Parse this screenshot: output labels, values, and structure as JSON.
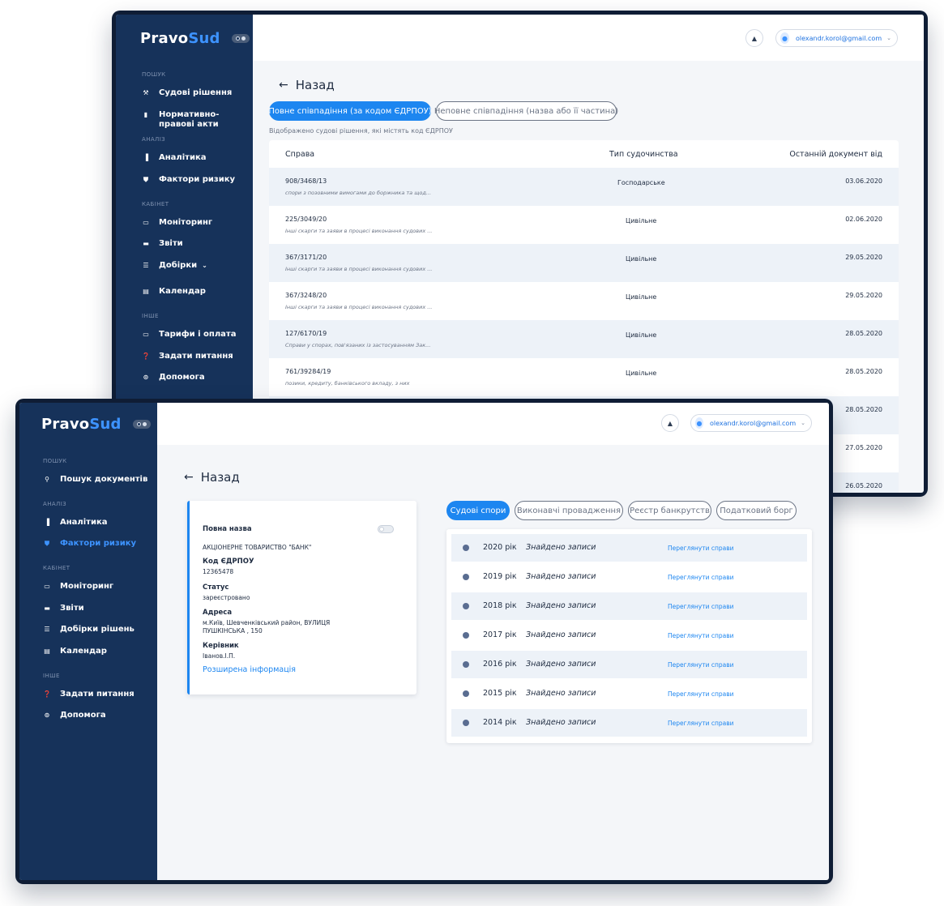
{
  "brand": {
    "name_a": "Pravo",
    "name_b": "Sud"
  },
  "back_label": "Назад",
  "win_back": {
    "sidebar": {
      "sections": [
        {
          "label": "ПОШУК",
          "items": [
            {
              "label": "Судові рішення",
              "icon": "gavel-icon"
            },
            {
              "label": "Нормативно-правові акти",
              "icon": "document-icon"
            }
          ]
        },
        {
          "label": "АНАЛІЗ",
          "items": [
            {
              "label": "Аналітика",
              "icon": "bar-chart-icon"
            },
            {
              "label": "Фактори ризику",
              "icon": "shield-icon"
            }
          ]
        },
        {
          "label": "КАБІНЕТ",
          "items": [
            {
              "label": "Моніторинг",
              "icon": "monitor-icon"
            },
            {
              "label": "Звіти",
              "icon": "folder-icon"
            },
            {
              "label": "Добірки",
              "icon": "list-icon"
            },
            {
              "label": "Календар",
              "icon": "calendar-icon"
            }
          ]
        },
        {
          "label": "ІНШЕ",
          "items": [
            {
              "label": "Тарифи і оплата",
              "icon": "card-icon"
            },
            {
              "label": "Задати питання",
              "icon": "question-icon"
            },
            {
              "label": "Допомога",
              "icon": "help-icon"
            }
          ]
        }
      ]
    },
    "user_email": "olexandr.korol@gmail.com",
    "tabs": [
      "Повне співпадіння (за кодом ЄДРПОУ)",
      "Неповне співпадіння (назва або її частина)"
    ],
    "note": "Відображено судові рішення, які містять код ЄДРПОУ",
    "columns": [
      "Справа",
      "Тип судочинства",
      "Останній документ від"
    ],
    "rows": [
      {
        "case": "908/3468/13",
        "desc": "спори з позовними вимогами до боржника та щод...",
        "type": "Господарське",
        "date": "03.06.2020"
      },
      {
        "case": "225/3049/20",
        "desc": "Інші скарги та заяви в процесі виконання судових ...",
        "type": "Цивільне",
        "date": "02.06.2020"
      },
      {
        "case": "367/3171/20",
        "desc": "Інші скарги та заяви в процесі виконання судових ...",
        "type": "Цивільне",
        "date": "29.05.2020"
      },
      {
        "case": "367/3248/20",
        "desc": "Інші скарги та заяви в процесі виконання судових ...",
        "type": "Цивільне",
        "date": "29.05.2020"
      },
      {
        "case": "127/6170/19",
        "desc": "Справи у спорах, пов'язаних із застосуванням Зак...",
        "type": "Цивільне",
        "date": "28.05.2020"
      },
      {
        "case": "761/39284/19",
        "desc": "позики, кредиту, банківського вкладу, з них",
        "type": "Цивільне",
        "date": "28.05.2020"
      },
      {
        "case": "",
        "desc": "",
        "type": "",
        "date": "28.05.2020"
      },
      {
        "case": "",
        "desc": "",
        "type": "",
        "date": "27.05.2020"
      },
      {
        "case": "",
        "desc": "",
        "type": "",
        "date": "26.05.2020"
      }
    ]
  },
  "win_front": {
    "sidebar": {
      "sections": [
        {
          "label": "ПОШУК",
          "items": [
            {
              "label": "Пошук документів",
              "icon": "search-icon"
            }
          ]
        },
        {
          "label": "АНАЛІЗ",
          "items": [
            {
              "label": "Аналітика",
              "icon": "bar-chart-icon"
            },
            {
              "label": "Фактори ризику",
              "icon": "shield-icon"
            }
          ]
        },
        {
          "label": "КАБІНЕТ",
          "items": [
            {
              "label": "Моніторинг",
              "icon": "monitor-icon"
            },
            {
              "label": "Звіти",
              "icon": "folder-icon"
            },
            {
              "label": "Добірки рішень",
              "icon": "list-icon"
            },
            {
              "label": "Календар",
              "icon": "calendar-icon"
            }
          ]
        },
        {
          "label": "ІНШЕ",
          "items": [
            {
              "label": "Задати питання",
              "icon": "question-icon"
            },
            {
              "label": "Допомога",
              "icon": "help-icon"
            }
          ]
        }
      ]
    },
    "user_email": "olexandr.korol@gmail.com",
    "card": {
      "full_name_label": "Повна назва",
      "full_name": "АКЦІОНЕРНЕ ТОВАРИСТВО \"БАНК\"",
      "code_label": "Код ЄДРПОУ",
      "code": "12365478",
      "status_label": "Статус",
      "status": "зареєстровано",
      "address_label": "Адреса",
      "address_1": "м.Київ, Шевченківський район, ВУЛИЦЯ",
      "address_2": "ПУШКІНСЬКА , 150",
      "head_label": "Керівник",
      "head": "Іванов.І.П.",
      "more_link": "Розширена інформація"
    },
    "tabs": [
      "Судові спори",
      "Виконавчі провадження",
      "Реєстр банкрутств",
      "Податковий борг"
    ],
    "years": [
      {
        "year": "2020 рік",
        "status": "Знайдено записи",
        "action": "Переглянути справи"
      },
      {
        "year": "2019 рік",
        "status": "Знайдено записи",
        "action": "Переглянути справи"
      },
      {
        "year": "2018 рік",
        "status": "Знайдено записи",
        "action": "Переглянути справи"
      },
      {
        "year": "2017 рік",
        "status": "Знайдено записи",
        "action": "Переглянути справи"
      },
      {
        "year": "2016 рік",
        "status": "Знайдено записи",
        "action": "Переглянути справи"
      },
      {
        "year": "2015 рік",
        "status": "Знайдено записи",
        "action": "Переглянути справи"
      },
      {
        "year": "2014 рік",
        "status": "Знайдено записи",
        "action": "Переглянути справи"
      }
    ]
  },
  "colors": {
    "sidebar": "#16325a",
    "frame": "#0f1d35",
    "accent": "#1d86f0",
    "row_alt": "#edf2f8"
  }
}
